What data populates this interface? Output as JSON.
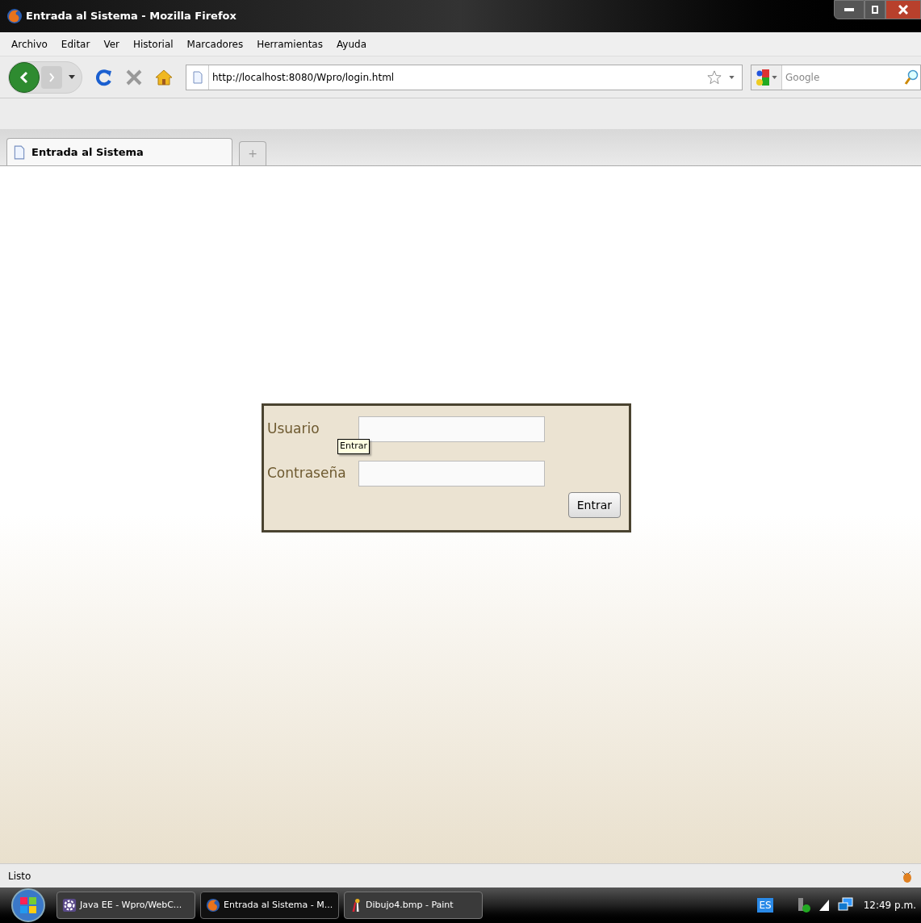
{
  "window": {
    "title": "Entrada al Sistema - Mozilla Firefox"
  },
  "menu": [
    "Archivo",
    "Editar",
    "Ver",
    "Historial",
    "Marcadores",
    "Herramientas",
    "Ayuda"
  ],
  "address_bar": {
    "value": "http://localhost:8080/Wpro/login.html"
  },
  "search": {
    "placeholder": "Google"
  },
  "tabs": [
    {
      "label": "Entrada al Sistema",
      "selected": true
    }
  ],
  "new_tab": "+",
  "login_form": {
    "fields": [
      {
        "label": "Usuario"
      },
      {
        "label": "Contraseña"
      }
    ],
    "button": "Entrar",
    "tooltip": "Entrar"
  },
  "status_bar": {
    "text": "Listo"
  },
  "taskbar": {
    "items": [
      {
        "label": "Java EE - Wpro/WebC...",
        "kind": "eclipse",
        "selected": false
      },
      {
        "label": "Entrada al Sistema - M...",
        "kind": "firefox",
        "selected": true
      },
      {
        "label": "Dibujo4.bmp - Paint",
        "kind": "paint",
        "selected": false
      }
    ],
    "language": "ES",
    "clock": "12:49 p.m."
  }
}
